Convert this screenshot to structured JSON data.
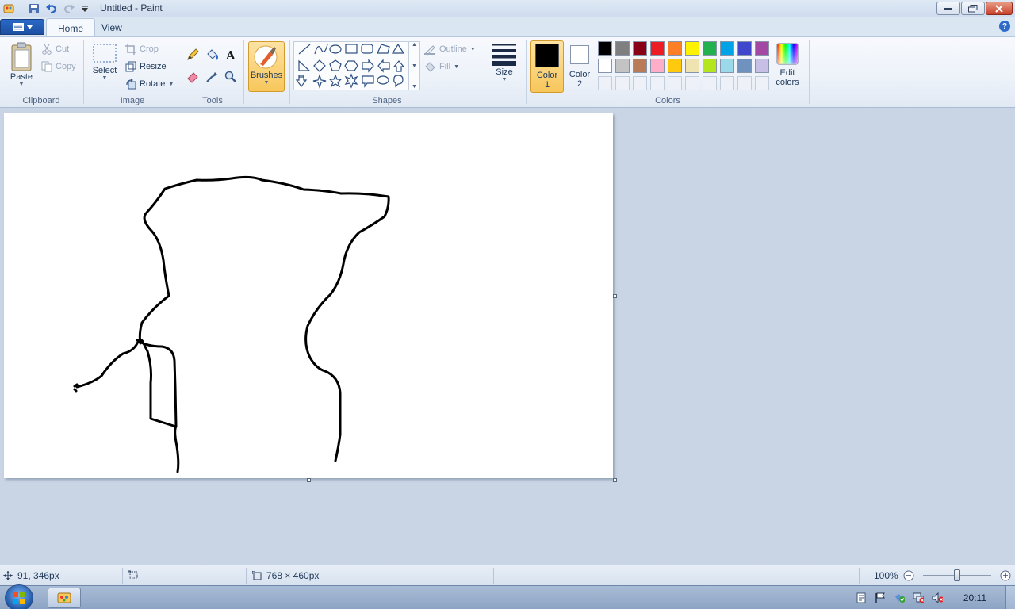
{
  "window": {
    "title": "Untitled - Paint"
  },
  "tabs": [
    {
      "label": "Home",
      "active": true
    },
    {
      "label": "View",
      "active": false
    }
  ],
  "ribbon": {
    "clipboard": {
      "label": "Clipboard",
      "paste": "Paste",
      "cut": "Cut",
      "copy": "Copy"
    },
    "image": {
      "label": "Image",
      "select": "Select",
      "crop": "Crop",
      "resize": "Resize",
      "rotate": "Rotate"
    },
    "tools": {
      "label": "Tools"
    },
    "brushes": {
      "label": "Brushes"
    },
    "shapes": {
      "label": "Shapes",
      "outline": "Outline",
      "fill": "Fill"
    },
    "size": {
      "label": "Size"
    },
    "colors": {
      "label": "Colors",
      "color1_line1": "Color",
      "color1_line2": "1",
      "color2_line1": "Color",
      "color2_line2": "2",
      "edit_line1": "Edit",
      "edit_line2": "colors",
      "color1": "#000000",
      "color2": "#ffffff",
      "palette": [
        "#000000",
        "#7f7f7f",
        "#880015",
        "#ed1c24",
        "#ff7f27",
        "#fff200",
        "#22b14c",
        "#00a2e8",
        "#3f48cc",
        "#a349a4",
        "#ffffff",
        "#c3c3c3",
        "#b97a57",
        "#ffaec9",
        "#ffc90e",
        "#efe4b0",
        "#b5e61d",
        "#99d9ea",
        "#7092be",
        "#c8bfe7"
      ]
    }
  },
  "status": {
    "cursor_pos": "91, 346px",
    "canvas_size": "768 × 460px",
    "zoom": "100%",
    "zoom_level": 100
  },
  "taskbar": {
    "clock": "20:11"
  }
}
